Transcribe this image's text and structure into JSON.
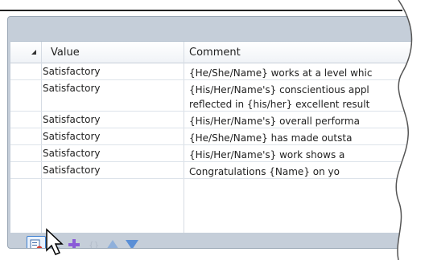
{
  "grid": {
    "columns": [
      "Value",
      "Comment"
    ],
    "rows": [
      {
        "value": "Satisfactory",
        "comment": "{He/She/Name} works at a level whic"
      },
      {
        "value": "Satisfactory",
        "comment": "{His/Her/Name's} conscientious appl",
        "comment2": "reflected in {his/her} excellent result"
      },
      {
        "value": "Satisfactory",
        "comment": "{His/Her/Name's} overall performa"
      },
      {
        "value": "Satisfactory",
        "comment": "{He/She/Name} has made outsta"
      },
      {
        "value": "Satisfactory",
        "comment": "{His/Her/Name's} work shows a"
      },
      {
        "value": "Satisfactory",
        "comment": "Congratulations {Name} on yo"
      }
    ]
  },
  "toolbar": {
    "icons": [
      "comment-bank-icon",
      "list-icon",
      "add-icon",
      "braces-icon",
      "move-up-icon",
      "move-down-icon"
    ]
  },
  "colors": {
    "panel": "#c5ced9",
    "accent": "#3c7fd1",
    "add": "#8a5bd8"
  }
}
